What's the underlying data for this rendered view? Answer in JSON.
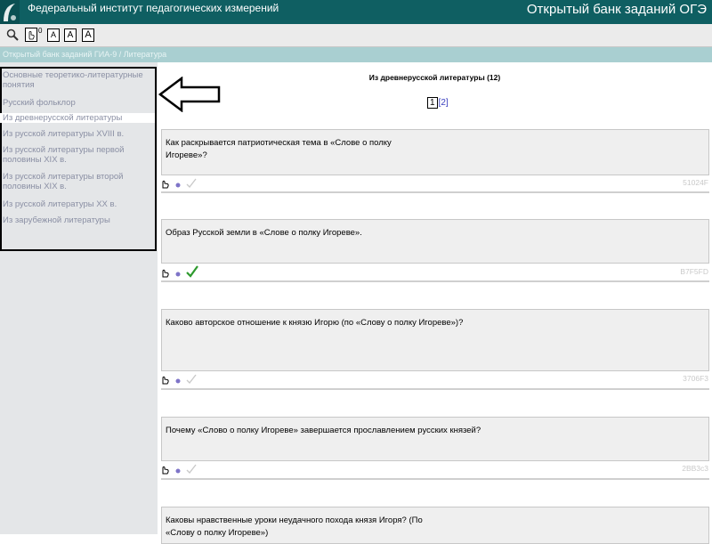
{
  "header": {
    "org_name": "Федеральный институт педагогических измерений",
    "bank_title": "Открытый банк заданий ОГЭ"
  },
  "toolbar": {
    "search_icon": "magnifier-icon",
    "counter_superscript": "0",
    "font_a1": "A",
    "font_a2": "A",
    "font_a3": "A"
  },
  "breadcrumb": "Открытый банк заданий ГИА-9 / Литература",
  "sidebar": {
    "items": [
      {
        "label": "Основные теоретико-литературные понятия"
      },
      {
        "label": "Русский фольклор"
      },
      {
        "label": "Из древнерусской литературы",
        "active": true
      },
      {
        "label": "Из русской литературы XVIII в."
      },
      {
        "label": "Из русской литературы первой половины XIX в."
      },
      {
        "label": "Из русской литературы второй половины XIX в."
      },
      {
        "label": "Из русской литературы XX в."
      },
      {
        "label": "Из зарубежной литературы"
      }
    ]
  },
  "main": {
    "section_title": "Из древнерусской литературы (12)",
    "pager": {
      "current": "1",
      "next": "[2]"
    },
    "tasks": [
      {
        "text": "Как раскрывается патриотическая тема в «Слове о полку Игореве»?",
        "code": "51024F",
        "done": false
      },
      {
        "text": "Образ Русской земли в «Слове о полку Игореве».",
        "code": "B7F5FD",
        "done": true
      },
      {
        "text": "Каково авторское отношение к князю Игорю (по «Слову о полку Игореве»)?",
        "code": "3706F3",
        "done": false
      },
      {
        "text": "Почему «Слово о полку Игореве» завершается прославлением русских князей?",
        "code": "2BB3c3",
        "done": false
      },
      {
        "text": "Каковы нравственные уроки неудачного похода князя Игоря? (По «Слову о полку Игореве»)",
        "code": "",
        "done": false
      }
    ]
  },
  "colors": {
    "header_bg": "#0f5f62",
    "breadcrumb_bg": "#a9cfd1",
    "sidebar_bg": "#e4e6e8",
    "sidebar_text": "#8a8fa4",
    "check_done": "#2e9a2e",
    "check_pending": "#c8c8c8",
    "pager_link": "#3a3fbf"
  }
}
